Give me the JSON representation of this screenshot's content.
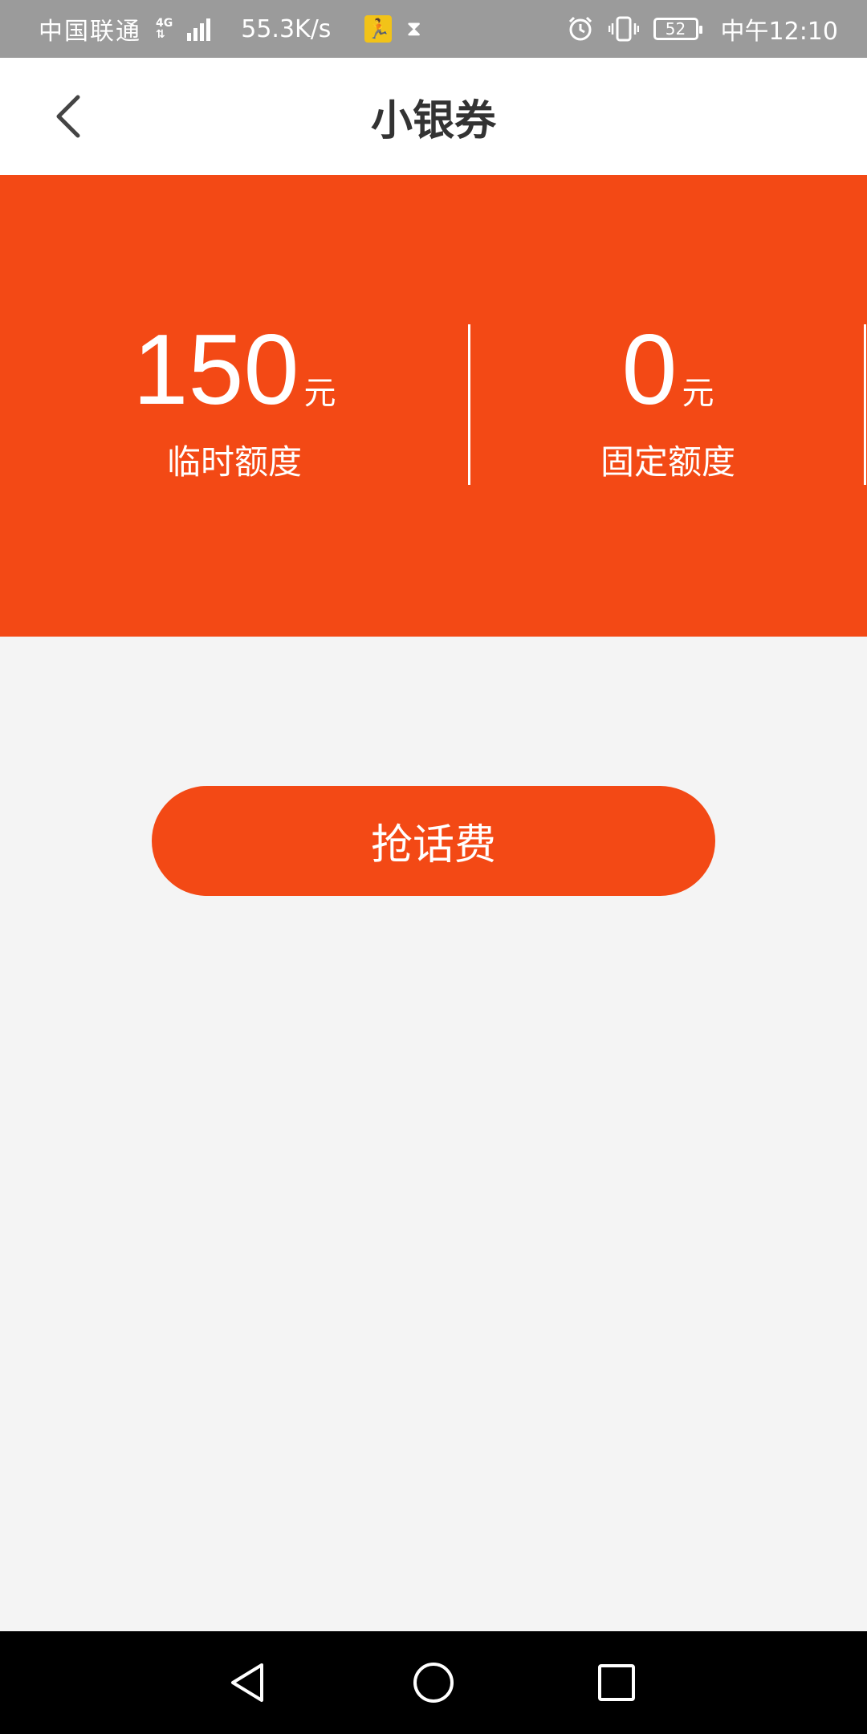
{
  "status_bar": {
    "carrier": "中国联通",
    "network_type": "4G",
    "network_sub": "⇅",
    "speed": "55.3K/s",
    "battery": "52",
    "time": "中午12:10"
  },
  "header": {
    "title": "小银券"
  },
  "banner": {
    "stats": [
      {
        "value": "150",
        "unit": "元",
        "label": "临时额度"
      },
      {
        "value": "0",
        "unit": "元",
        "label": "固定额度"
      }
    ]
  },
  "action": {
    "label": "抢话费"
  },
  "colors": {
    "accent": "#f34915",
    "background": "#f4f4f4",
    "status_bar": "#9b9b9b"
  },
  "icons": {
    "back": "chevron-left-icon",
    "nav_back": "triangle-back-icon",
    "nav_home": "circle-home-icon",
    "nav_recent": "square-recent-icon"
  }
}
